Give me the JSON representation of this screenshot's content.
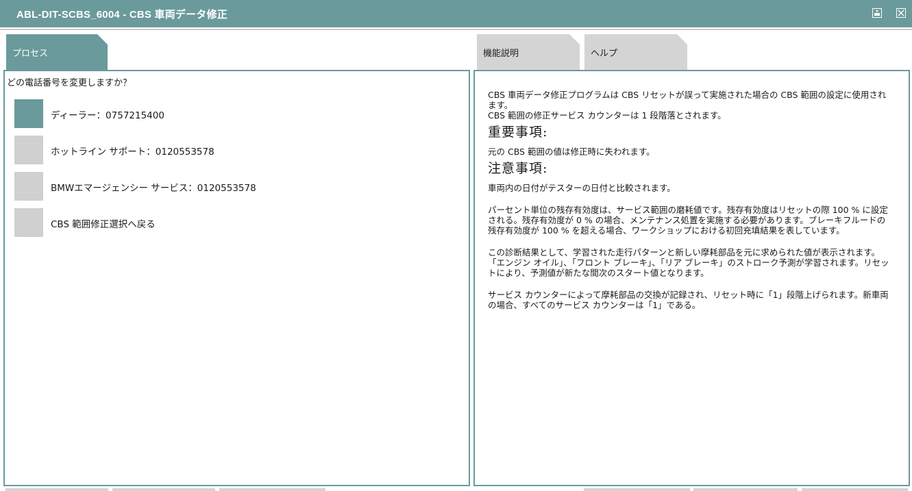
{
  "window": {
    "title": "ABL-DIT-SCBS_6004  -  CBS 車両データ修正"
  },
  "tabs": {
    "process": "プロセス",
    "function_description": "機能説明",
    "help": "ヘルプ"
  },
  "process_panel": {
    "question": "どの電話番号を変更しますか？",
    "options": [
      {
        "label": "ディーラー：0757215400",
        "selected": true
      },
      {
        "label": "ホットライン サポート：0120553578",
        "selected": false
      },
      {
        "label": "BMWエマージェンシー サービス：0120553578",
        "selected": false
      },
      {
        "label": "CBS 範囲修正選択へ戻る",
        "selected": false
      }
    ]
  },
  "help_panel": {
    "intro_1": "CBS 車両データ修正プログラムは CBS リセットが誤って実施された場合の CBS 範囲の設定に使用されます。",
    "intro_2": "CBS 範囲の修正サービス カウンターは 1 段階落とされます。",
    "important_heading": "重要事項:",
    "important_text": "元の CBS 範囲の値は修正時に失われます。",
    "note_heading": "注意事項:",
    "note_1": "車両内の日付がテスターの日付と比較されます。",
    "note_2": "パーセント単位の残存有効度は、サービス範囲の磨耗値です。残存有効度はリセットの際 100 % に設定される。残存有効度が 0 % の場合、メンテナンス処置を実施する必要があります。ブレーキフルードの残存有効度が 100 % を超える場合、ワークショップにおける初回充填結果を表しています。",
    "note_3": "この診断結果として、学習された走行パターンと新しい摩耗部品を元に求められた値が表示されます。「エンジン オイル」、「フロント ブレーキ」、「リア ブレーキ」のストローク予測が学習されます。リセットにより、予測値が新たな間次のスタート値となります。",
    "note_4": "サービス カウンターによって摩耗部品の交換が記録され、リセット時に「1」段階上げられます。新車両の場合、すべてのサービス カウンターは「1」である。"
  },
  "colors": {
    "accent": "#6b9a9c",
    "inactive_tab": "#d4d4d4",
    "option_box": "#d0d0d0"
  }
}
